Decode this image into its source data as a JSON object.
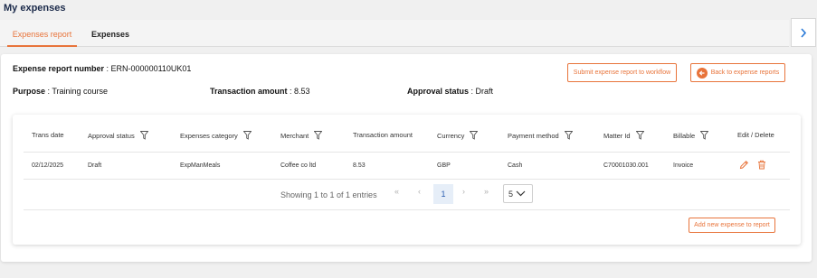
{
  "app": {
    "title": "My expenses"
  },
  "tabs": [
    {
      "label": "Expenses report",
      "active": true
    },
    {
      "label": "Expenses",
      "active": false
    }
  ],
  "side_toggle": {
    "icon": "chevron-right-icon"
  },
  "report": {
    "number_label": "Expense report number",
    "number_value": "ERN-000000110UK01",
    "purpose_label": "Purpose",
    "purpose_value": "Training course",
    "amount_label": "Transaction amount",
    "amount_value": "8.53",
    "status_label": "Approval status",
    "status_value": "Draft",
    "sep": " : "
  },
  "actions": {
    "submit_label": "Submit expense report to workflow",
    "back_label": "Back to expense reports",
    "add_label": "Add new expense to report"
  },
  "table": {
    "columns": [
      {
        "label": "Trans date",
        "filter": false
      },
      {
        "label": "Approval status",
        "filter": true
      },
      {
        "label": "Expenses category",
        "filter": true
      },
      {
        "label": "Merchant",
        "filter": true
      },
      {
        "label": "Transaction amount",
        "filter": false
      },
      {
        "label": "Currency",
        "filter": true
      },
      {
        "label": "Payment method",
        "filter": true
      },
      {
        "label": "Matter Id",
        "filter": true
      },
      {
        "label": "Billable",
        "filter": true
      },
      {
        "label": "Edit / Delete",
        "filter": false
      }
    ],
    "rows": [
      [
        "02/12/2025",
        "Draft",
        "ExpManMeals",
        "Coffee co ltd",
        "8.53",
        "GBP",
        "Cash",
        "C70001030.001",
        "Invoice"
      ]
    ]
  },
  "pager": {
    "summary": "Showing 1 to 1 of 1 entries",
    "first": "«",
    "prev": "‹",
    "current_page": "1",
    "next": "›",
    "last": "»",
    "page_size": "5"
  },
  "colors": {
    "accent": "#e8743b",
    "title": "#1b2a4a",
    "page_active_bg": "#e6eef8"
  }
}
